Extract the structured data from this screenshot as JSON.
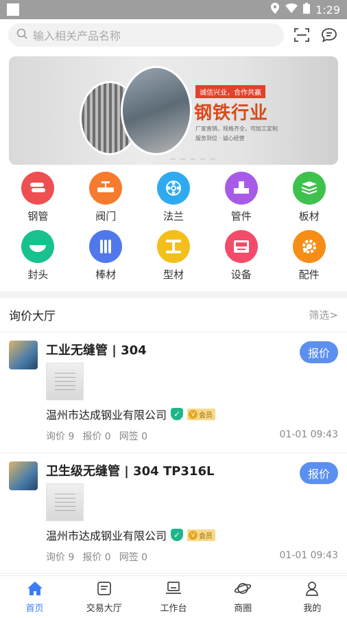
{
  "status": {
    "time": "1:29"
  },
  "search": {
    "placeholder": "输入相关产品名称"
  },
  "banner": {
    "tagline": "诚信兴业，合作共赢",
    "title": "钢铁行业",
    "line1": "厂家直销，规格齐全，可加工定制",
    "line2": "服务到位 · 诚心经营"
  },
  "categories": [
    {
      "label": "钢管",
      "color": "#ef4f51"
    },
    {
      "label": "阀门",
      "color": "#f77b2e"
    },
    {
      "label": "法兰",
      "color": "#2eaaf0"
    },
    {
      "label": "管件",
      "color": "#a85be8"
    },
    {
      "label": "板材",
      "color": "#3fc14d"
    },
    {
      "label": "封头",
      "color": "#18c18d"
    },
    {
      "label": "棒材",
      "color": "#5078ec"
    },
    {
      "label": "型材",
      "color": "#f3bf1a"
    },
    {
      "label": "设备",
      "color": "#f24c6a"
    },
    {
      "label": "配件",
      "color": "#f58d16"
    }
  ],
  "section": {
    "title": "询价大厅",
    "filter": "筛选>"
  },
  "items": [
    {
      "title": "工业无缝管 | 304",
      "company": "温州市达成钢业有限公司",
      "vip": "会员",
      "inquiry": "询价 9",
      "quotes": "报价 0",
      "signed": "网签 0",
      "date": "01-01 09:43",
      "button": "报价"
    },
    {
      "title": "卫生级无缝管 | 304 TP316L",
      "company": "温州市达成钢业有限公司",
      "vip": "会员",
      "inquiry": "询价 9",
      "quotes": "报价 0",
      "signed": "网签 0",
      "date": "01-01 09:43",
      "button": "报价"
    }
  ],
  "tabs": [
    {
      "label": "首页",
      "icon": "home-icon"
    },
    {
      "label": "交易大厅",
      "icon": "list-icon"
    },
    {
      "label": "工作台",
      "icon": "laptop-icon"
    },
    {
      "label": "商圈",
      "icon": "planet-icon"
    },
    {
      "label": "我的",
      "icon": "user-icon"
    }
  ],
  "colors": {
    "accent": "#3b7cf5",
    "quote_button": "#5b8ff0"
  }
}
